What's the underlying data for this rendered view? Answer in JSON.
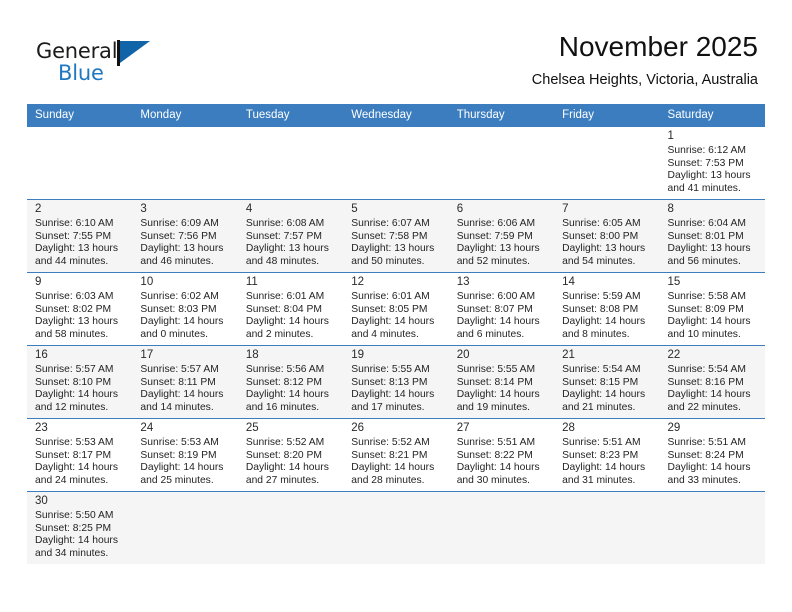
{
  "brand": {
    "name_top": "General",
    "name_bottom": "Blue",
    "flag_icon": "blue-flag-icon",
    "accent_color": "#1f78c1"
  },
  "header": {
    "title": "November 2025",
    "subtitle": "Chelsea Heights, Victoria, Australia"
  },
  "calendar": {
    "header_bg": "#3b7dbf",
    "weekdays": [
      "Sunday",
      "Monday",
      "Tuesday",
      "Wednesday",
      "Thursday",
      "Friday",
      "Saturday"
    ],
    "weeks": [
      [
        {
          "day": "",
          "sunrise": "",
          "sunset": "",
          "daylight1": "",
          "daylight2": ""
        },
        {
          "day": "",
          "sunrise": "",
          "sunset": "",
          "daylight1": "",
          "daylight2": ""
        },
        {
          "day": "",
          "sunrise": "",
          "sunset": "",
          "daylight1": "",
          "daylight2": ""
        },
        {
          "day": "",
          "sunrise": "",
          "sunset": "",
          "daylight1": "",
          "daylight2": ""
        },
        {
          "day": "",
          "sunrise": "",
          "sunset": "",
          "daylight1": "",
          "daylight2": ""
        },
        {
          "day": "",
          "sunrise": "",
          "sunset": "",
          "daylight1": "",
          "daylight2": ""
        },
        {
          "day": "1",
          "sunrise": "Sunrise: 6:12 AM",
          "sunset": "Sunset: 7:53 PM",
          "daylight1": "Daylight: 13 hours",
          "daylight2": "and 41 minutes."
        }
      ],
      [
        {
          "day": "2",
          "sunrise": "Sunrise: 6:10 AM",
          "sunset": "Sunset: 7:55 PM",
          "daylight1": "Daylight: 13 hours",
          "daylight2": "and 44 minutes."
        },
        {
          "day": "3",
          "sunrise": "Sunrise: 6:09 AM",
          "sunset": "Sunset: 7:56 PM",
          "daylight1": "Daylight: 13 hours",
          "daylight2": "and 46 minutes."
        },
        {
          "day": "4",
          "sunrise": "Sunrise: 6:08 AM",
          "sunset": "Sunset: 7:57 PM",
          "daylight1": "Daylight: 13 hours",
          "daylight2": "and 48 minutes."
        },
        {
          "day": "5",
          "sunrise": "Sunrise: 6:07 AM",
          "sunset": "Sunset: 7:58 PM",
          "daylight1": "Daylight: 13 hours",
          "daylight2": "and 50 minutes."
        },
        {
          "day": "6",
          "sunrise": "Sunrise: 6:06 AM",
          "sunset": "Sunset: 7:59 PM",
          "daylight1": "Daylight: 13 hours",
          "daylight2": "and 52 minutes."
        },
        {
          "day": "7",
          "sunrise": "Sunrise: 6:05 AM",
          "sunset": "Sunset: 8:00 PM",
          "daylight1": "Daylight: 13 hours",
          "daylight2": "and 54 minutes."
        },
        {
          "day": "8",
          "sunrise": "Sunrise: 6:04 AM",
          "sunset": "Sunset: 8:01 PM",
          "daylight1": "Daylight: 13 hours",
          "daylight2": "and 56 minutes."
        }
      ],
      [
        {
          "day": "9",
          "sunrise": "Sunrise: 6:03 AM",
          "sunset": "Sunset: 8:02 PM",
          "daylight1": "Daylight: 13 hours",
          "daylight2": "and 58 minutes."
        },
        {
          "day": "10",
          "sunrise": "Sunrise: 6:02 AM",
          "sunset": "Sunset: 8:03 PM",
          "daylight1": "Daylight: 14 hours",
          "daylight2": "and 0 minutes."
        },
        {
          "day": "11",
          "sunrise": "Sunrise: 6:01 AM",
          "sunset": "Sunset: 8:04 PM",
          "daylight1": "Daylight: 14 hours",
          "daylight2": "and 2 minutes."
        },
        {
          "day": "12",
          "sunrise": "Sunrise: 6:01 AM",
          "sunset": "Sunset: 8:05 PM",
          "daylight1": "Daylight: 14 hours",
          "daylight2": "and 4 minutes."
        },
        {
          "day": "13",
          "sunrise": "Sunrise: 6:00 AM",
          "sunset": "Sunset: 8:07 PM",
          "daylight1": "Daylight: 14 hours",
          "daylight2": "and 6 minutes."
        },
        {
          "day": "14",
          "sunrise": "Sunrise: 5:59 AM",
          "sunset": "Sunset: 8:08 PM",
          "daylight1": "Daylight: 14 hours",
          "daylight2": "and 8 minutes."
        },
        {
          "day": "15",
          "sunrise": "Sunrise: 5:58 AM",
          "sunset": "Sunset: 8:09 PM",
          "daylight1": "Daylight: 14 hours",
          "daylight2": "and 10 minutes."
        }
      ],
      [
        {
          "day": "16",
          "sunrise": "Sunrise: 5:57 AM",
          "sunset": "Sunset: 8:10 PM",
          "daylight1": "Daylight: 14 hours",
          "daylight2": "and 12 minutes."
        },
        {
          "day": "17",
          "sunrise": "Sunrise: 5:57 AM",
          "sunset": "Sunset: 8:11 PM",
          "daylight1": "Daylight: 14 hours",
          "daylight2": "and 14 minutes."
        },
        {
          "day": "18",
          "sunrise": "Sunrise: 5:56 AM",
          "sunset": "Sunset: 8:12 PM",
          "daylight1": "Daylight: 14 hours",
          "daylight2": "and 16 minutes."
        },
        {
          "day": "19",
          "sunrise": "Sunrise: 5:55 AM",
          "sunset": "Sunset: 8:13 PM",
          "daylight1": "Daylight: 14 hours",
          "daylight2": "and 17 minutes."
        },
        {
          "day": "20",
          "sunrise": "Sunrise: 5:55 AM",
          "sunset": "Sunset: 8:14 PM",
          "daylight1": "Daylight: 14 hours",
          "daylight2": "and 19 minutes."
        },
        {
          "day": "21",
          "sunrise": "Sunrise: 5:54 AM",
          "sunset": "Sunset: 8:15 PM",
          "daylight1": "Daylight: 14 hours",
          "daylight2": "and 21 minutes."
        },
        {
          "day": "22",
          "sunrise": "Sunrise: 5:54 AM",
          "sunset": "Sunset: 8:16 PM",
          "daylight1": "Daylight: 14 hours",
          "daylight2": "and 22 minutes."
        }
      ],
      [
        {
          "day": "23",
          "sunrise": "Sunrise: 5:53 AM",
          "sunset": "Sunset: 8:17 PM",
          "daylight1": "Daylight: 14 hours",
          "daylight2": "and 24 minutes."
        },
        {
          "day": "24",
          "sunrise": "Sunrise: 5:53 AM",
          "sunset": "Sunset: 8:19 PM",
          "daylight1": "Daylight: 14 hours",
          "daylight2": "and 25 minutes."
        },
        {
          "day": "25",
          "sunrise": "Sunrise: 5:52 AM",
          "sunset": "Sunset: 8:20 PM",
          "daylight1": "Daylight: 14 hours",
          "daylight2": "and 27 minutes."
        },
        {
          "day": "26",
          "sunrise": "Sunrise: 5:52 AM",
          "sunset": "Sunset: 8:21 PM",
          "daylight1": "Daylight: 14 hours",
          "daylight2": "and 28 minutes."
        },
        {
          "day": "27",
          "sunrise": "Sunrise: 5:51 AM",
          "sunset": "Sunset: 8:22 PM",
          "daylight1": "Daylight: 14 hours",
          "daylight2": "and 30 minutes."
        },
        {
          "day": "28",
          "sunrise": "Sunrise: 5:51 AM",
          "sunset": "Sunset: 8:23 PM",
          "daylight1": "Daylight: 14 hours",
          "daylight2": "and 31 minutes."
        },
        {
          "day": "29",
          "sunrise": "Sunrise: 5:51 AM",
          "sunset": "Sunset: 8:24 PM",
          "daylight1": "Daylight: 14 hours",
          "daylight2": "and 33 minutes."
        }
      ],
      [
        {
          "day": "30",
          "sunrise": "Sunrise: 5:50 AM",
          "sunset": "Sunset: 8:25 PM",
          "daylight1": "Daylight: 14 hours",
          "daylight2": "and 34 minutes."
        },
        {
          "day": "",
          "sunrise": "",
          "sunset": "",
          "daylight1": "",
          "daylight2": ""
        },
        {
          "day": "",
          "sunrise": "",
          "sunset": "",
          "daylight1": "",
          "daylight2": ""
        },
        {
          "day": "",
          "sunrise": "",
          "sunset": "",
          "daylight1": "",
          "daylight2": ""
        },
        {
          "day": "",
          "sunrise": "",
          "sunset": "",
          "daylight1": "",
          "daylight2": ""
        },
        {
          "day": "",
          "sunrise": "",
          "sunset": "",
          "daylight1": "",
          "daylight2": ""
        },
        {
          "day": "",
          "sunrise": "",
          "sunset": "",
          "daylight1": "",
          "daylight2": ""
        }
      ]
    ]
  }
}
